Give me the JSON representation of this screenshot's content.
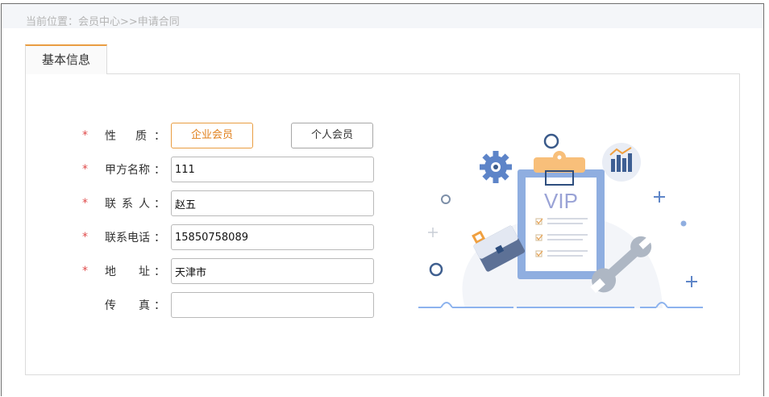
{
  "breadcrumb": {
    "text": "当前位置：会员中心>>申请合同"
  },
  "tabs": [
    {
      "label": "基本信息"
    }
  ],
  "form": {
    "nature": {
      "label": "性质",
      "required": true,
      "options": [
        "企业会员",
        "个人会员"
      ],
      "selected": "企业会员"
    },
    "party_a_name": {
      "label": "甲方名称",
      "value": "111",
      "required": true
    },
    "contact": {
      "label": "联系人",
      "value": "赵五",
      "required": true
    },
    "phone": {
      "label": "联系电话",
      "value": "15850758089",
      "required": true
    },
    "address": {
      "label": "地址",
      "value": "天津市",
      "required": true
    },
    "fax": {
      "label": "传真",
      "value": "",
      "required": false
    },
    "required_mark": "*",
    "colon": "："
  },
  "illustration": {
    "vip_text": "VIP",
    "icons": [
      "gear-icon",
      "chart-icon",
      "clipboard-icon",
      "briefcase-icon",
      "wrench-icon"
    ]
  },
  "colors": {
    "accent": "#e99d42",
    "required": "#e04b4b",
    "clipboard": "#8faee0",
    "clip_orange": "#f8bf7a",
    "vip_text": "#9aa3d6",
    "line": "#8db3ee"
  }
}
